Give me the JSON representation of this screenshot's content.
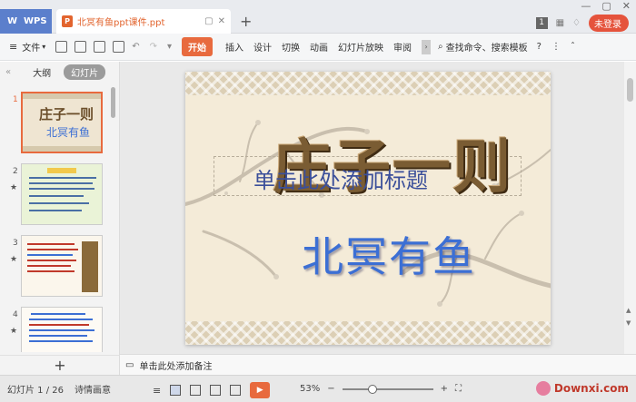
{
  "titlebar": {
    "app_tab": "WPS",
    "doc_tab": "北冥有鱼ppt课件.ppt",
    "badge": "1",
    "unlogin": "未登录"
  },
  "menubar": {
    "file": "文件",
    "start": "开始",
    "items": [
      "插入",
      "设计",
      "切换",
      "动画",
      "幻灯片放映",
      "审阅"
    ],
    "search": "查找命令、搜索模板"
  },
  "leftpanel": {
    "tab_outline": "大纲",
    "tab_slides": "幻灯片",
    "numbers": [
      "1",
      "2",
      "3",
      "4"
    ],
    "thumb1_title": "庄子一则",
    "thumb1_sub": "北冥有鱼"
  },
  "slide": {
    "big_title": "庄子一则",
    "placeholder": "单击此处添加标题",
    "subtitle": "北冥有鱼"
  },
  "notes": {
    "text": "单击此处添加备注"
  },
  "statusbar": {
    "slide_info": "幻灯片 1 / 26",
    "theme": "诗情画意",
    "zoom": "53%",
    "watermark": "Downxi.com",
    "zoom_level": 0.53
  },
  "colors": {
    "accent": "#e86a3e",
    "wps_blue": "#5b7fcc",
    "subtitle_blue": "#3c6fd4"
  }
}
